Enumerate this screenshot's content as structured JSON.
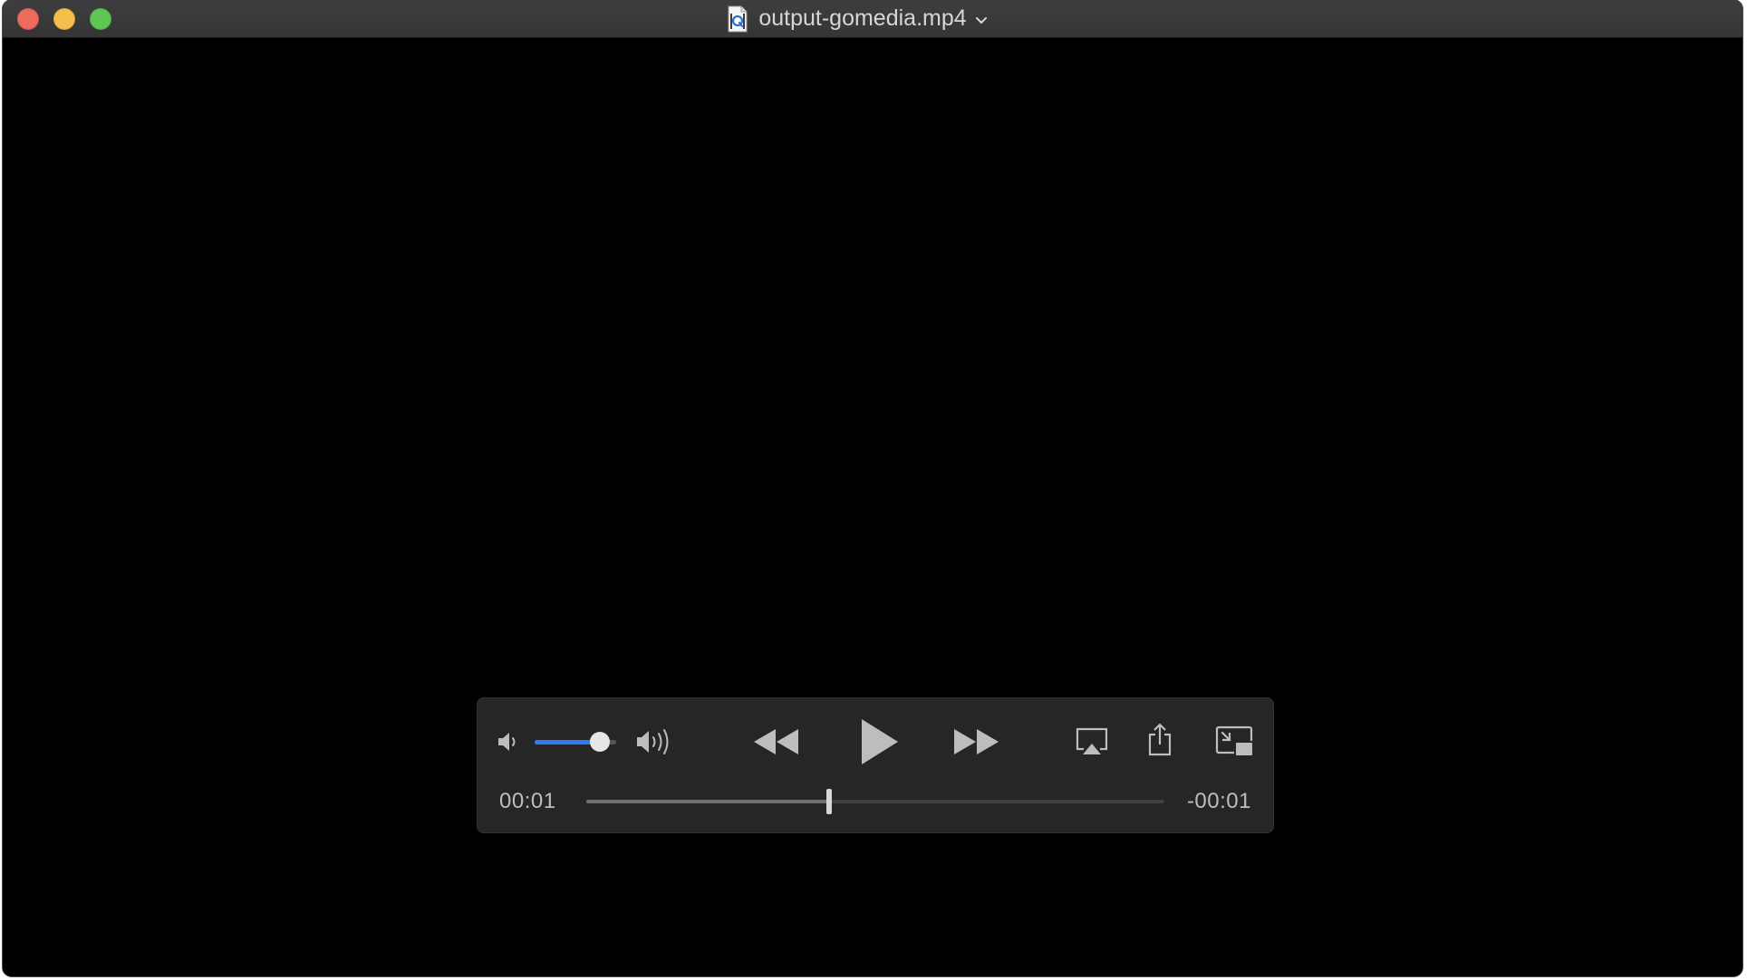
{
  "window": {
    "title": "output-gomedia.mp4",
    "title_icon": "quicktime-document-icon",
    "title_menu_icon": "chevron-down-icon"
  },
  "traffic_lights": {
    "close_color": "#ed6a5e",
    "minimize_color": "#f5bf4f",
    "zoom_color": "#61c554"
  },
  "player": {
    "volume_level": 0.8,
    "accent_color": "#2f7bf5",
    "progress": 0.42,
    "elapsed_time": "00:01",
    "remaining_time": "-00:01",
    "state": "paused",
    "buttons": {
      "mute_icon": "speaker-low-icon",
      "max_volume_icon": "speaker-high-icon",
      "rewind_icon": "rewind-icon",
      "play_icon": "play-icon",
      "fast_forward_icon": "fast-forward-icon",
      "airplay_icon": "airplay-icon",
      "share_icon": "share-icon",
      "pip_icon": "picture-in-picture-icon"
    }
  }
}
